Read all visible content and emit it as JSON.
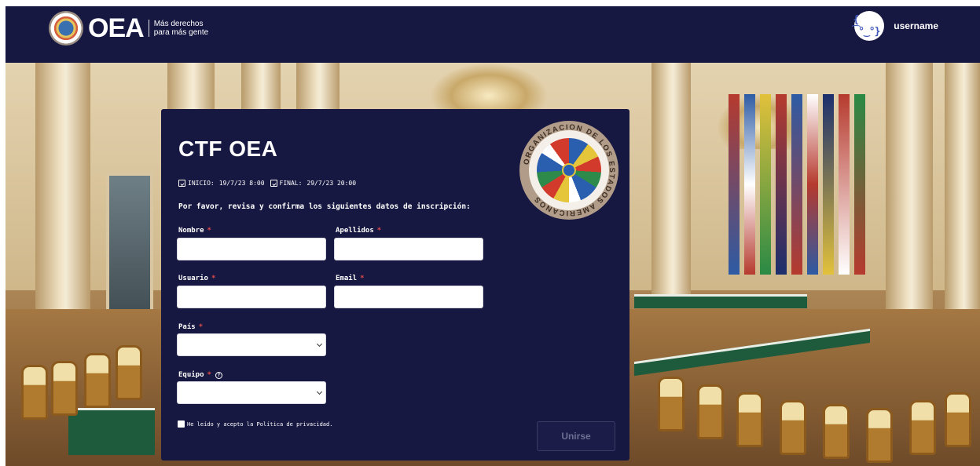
{
  "header": {
    "brand": "OEA",
    "tagline_line1": "Más derechos",
    "tagline_line2": "para más gente",
    "avatar_glyph": "{ ͡°‿°}",
    "username": "username"
  },
  "form": {
    "title": "CTF OEA",
    "start_label": "INICIO:",
    "start_value": "19/7/23 8:00",
    "end_label": "FINAL:",
    "end_value": "29/7/23 20:00",
    "confirm_text": "Por favor, revisa y confirma los siguientes datos de inscripción:",
    "fields": {
      "nombre": {
        "label": "Nombre",
        "value": "",
        "required_mark": "*"
      },
      "apellidos": {
        "label": "Apellidos",
        "value": "",
        "required_mark": "*"
      },
      "usuario": {
        "label": "Usuario",
        "value": "",
        "required_mark": "*"
      },
      "email": {
        "label": "Email",
        "value": "",
        "required_mark": "*"
      },
      "pais": {
        "label": "País",
        "value": "",
        "required_mark": "*"
      },
      "equipo": {
        "label": "Equipo",
        "value": "",
        "required_mark": "*",
        "help_glyph": "?"
      }
    },
    "terms_text": "He leído y acepto la Política de privacidad.",
    "terms_checked": false,
    "submit_label": "Unirse"
  },
  "seal": {
    "ring_text": "ORGANIZACION DE LOS ESTADOS AMERICANOS"
  },
  "colors": {
    "navy": "#171842",
    "required": "#e34b4b"
  }
}
